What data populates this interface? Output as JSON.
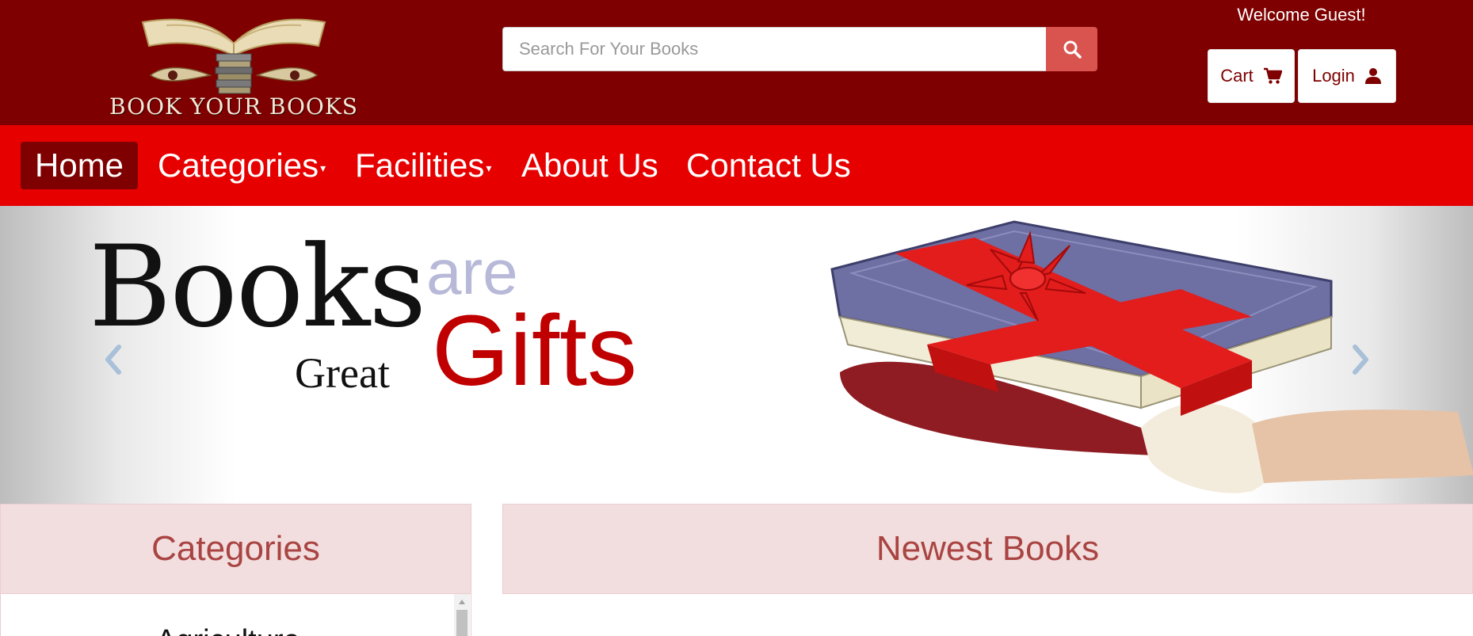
{
  "header": {
    "logo_text": "BOOK YOUR BOOKS",
    "search_placeholder": "Search For Your Books",
    "search_icon": "search-icon",
    "welcome_text": "Welcome Guest!",
    "cart_label": "Cart",
    "cart_icon": "cart-icon",
    "login_label": "Login",
    "login_icon": "user-icon"
  },
  "nav": {
    "items": [
      {
        "label": "Home",
        "active": true
      },
      {
        "label": "Categories",
        "caret": "▾"
      },
      {
        "label": "Facilities",
        "caret": "▾"
      },
      {
        "label": "About Us"
      },
      {
        "label": "Contact Us"
      }
    ]
  },
  "carousel": {
    "slide_text": {
      "books": "Books",
      "are": "are",
      "great": "Great",
      "gifts": "Gifts"
    },
    "prev_icon": "chevron-left-icon",
    "next_icon": "chevron-right-icon"
  },
  "categories_panel": {
    "title": "Categories",
    "items": [
      "Agriculture"
    ]
  },
  "newest_panel": {
    "title": "Newest Books"
  },
  "colors": {
    "header_bg": "#7e0000",
    "nav_bg": "#e60000",
    "nav_active_bg": "#7e0000",
    "search_button": "#d9534f",
    "panel_bg": "#f2dede",
    "panel_text": "#a94442",
    "gifts_red": "#c00000"
  }
}
